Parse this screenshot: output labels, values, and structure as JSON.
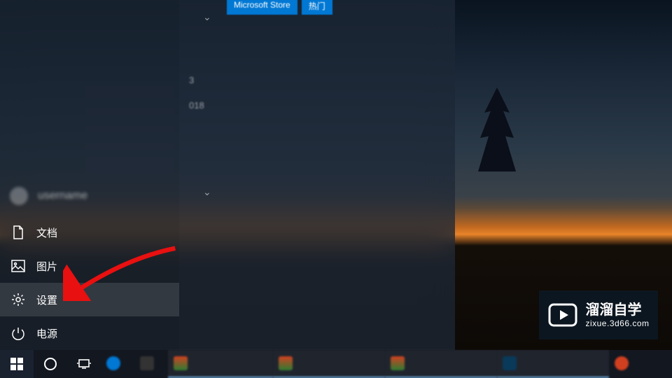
{
  "start_menu": {
    "user_name": "username",
    "items": [
      {
        "id": "documents",
        "label": "文档",
        "icon": "document-icon"
      },
      {
        "id": "pictures",
        "label": "图片",
        "icon": "picture-icon"
      },
      {
        "id": "settings",
        "label": "设置",
        "icon": "gear-icon",
        "highlighted": true
      },
      {
        "id": "power",
        "label": "电源",
        "icon": "power-icon"
      }
    ],
    "badges": [
      "Microsoft Store",
      "热门"
    ],
    "app_hints": [
      "3",
      "018"
    ]
  },
  "taskbar": {
    "start": "开始",
    "cortana": "Cortana",
    "taskview": "任务视图",
    "apps": [
      {
        "color": "#0078d4"
      },
      {
        "color": "#444"
      },
      {
        "color": "#2e7d32",
        "label": ""
      },
      {
        "color": "#2e7d32",
        "label": ""
      },
      {
        "color": "#2e7d32",
        "label": ""
      },
      {
        "color": "#0078d4",
        "label": ""
      },
      {
        "color": "#d04020",
        "label": ""
      }
    ]
  },
  "watermark": {
    "main": "溜溜自学",
    "url": "zixue.3d66.com"
  },
  "annotation": {
    "target": "settings"
  }
}
